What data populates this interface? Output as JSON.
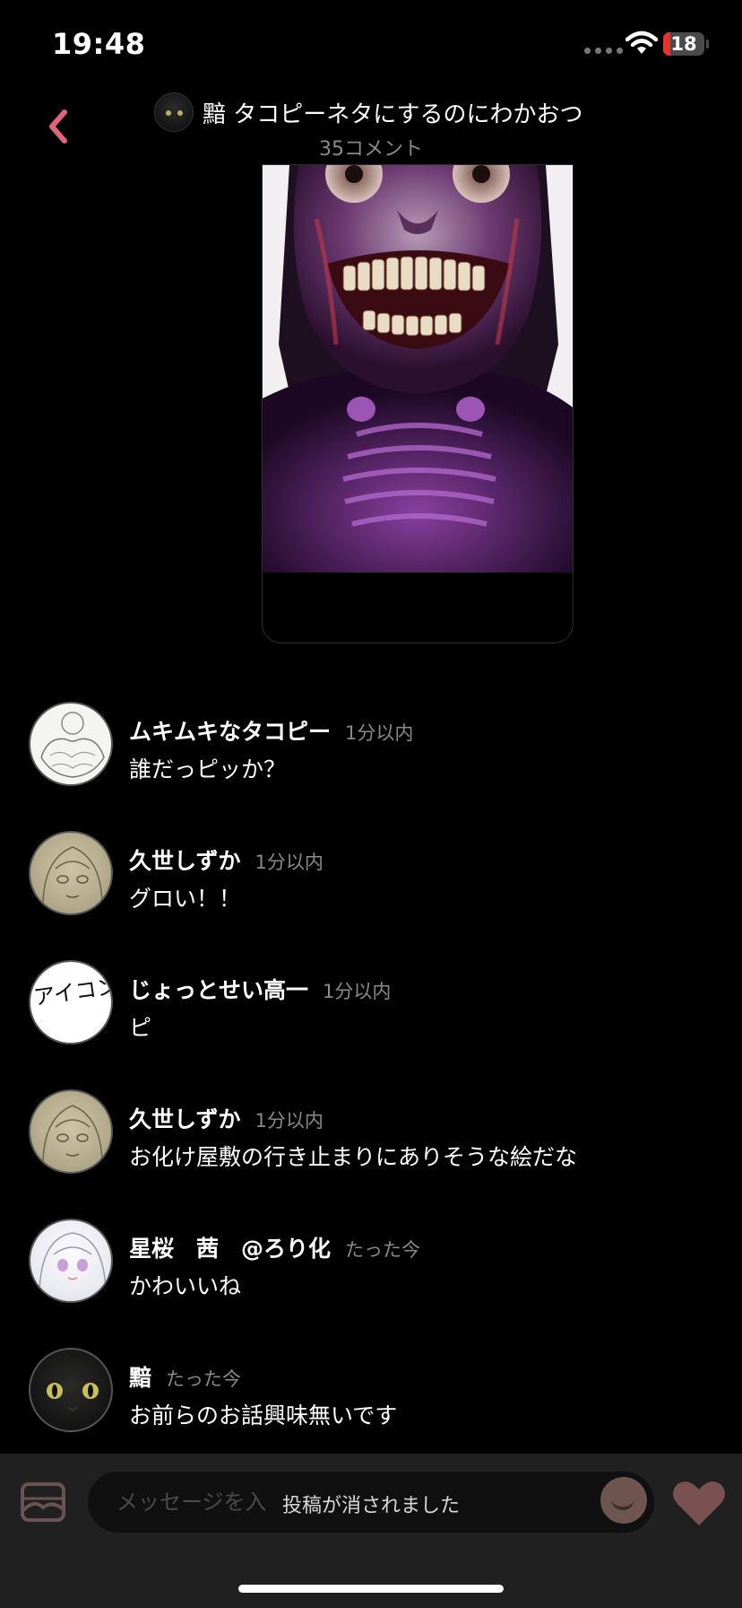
{
  "status_bar": {
    "time": "19:48",
    "battery": "18",
    "battery_level": 0.18
  },
  "header": {
    "back_icon": "chevron-left-icon",
    "title": "黯 タコピーネタにするのにわかおつ",
    "comment_count": "35コメント"
  },
  "comments": [
    {
      "name": "ムキムキなタコピー",
      "time": "1分以内",
      "text": "誰だっピッか？"
    },
    {
      "name": "久世しずか",
      "time": "1分以内",
      "text": "グロい！！"
    },
    {
      "name": "じょっとせい高一",
      "time": "1分以内",
      "text": "ピ"
    },
    {
      "name": "久世しずか",
      "time": "1分以内",
      "text": "お化け屋敷の行き止まりにありそうな絵だな"
    },
    {
      "name": "星桜　茜　@ろり化",
      "time": "たった今",
      "text": "かわいいね"
    },
    {
      "name": "黯",
      "time": "たった今",
      "text": "お前らのお話興味無いです"
    }
  ],
  "avatar_text": "アイコンです",
  "composer": {
    "placeholder": "メッセージを入",
    "toast": "投稿が消されました"
  },
  "colors": {
    "accent": "#e0647a",
    "heart": "#7a5050",
    "background": "#000000"
  }
}
